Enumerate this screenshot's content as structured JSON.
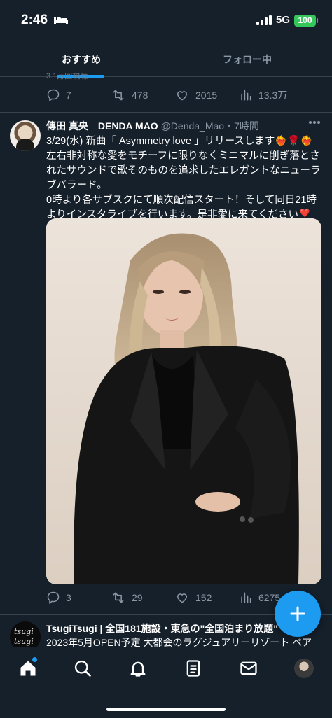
{
  "status_bar": {
    "time": "2:46",
    "network": "5G",
    "battery": "100"
  },
  "tabs": [
    {
      "label": "おすすめ",
      "active": true
    },
    {
      "label": "フォロー中",
      "active": false
    }
  ],
  "prev_tweet": {
    "cut_text": "3.1万回視聴",
    "replies": "7",
    "retweets": "478",
    "likes": "2015",
    "views": "13.3万"
  },
  "tweet": {
    "name": "傳田 真央　DENDA MAO",
    "handle": "@Denda_Mao",
    "time": "・7時間",
    "lines": [
      "3/29(水) 新曲「 Asymmetry love 」リリースします❤️‍🔥🌹❤️‍🔥",
      "左右非対称な愛をモチーフに限りなくミニマルに削ぎ落とされたサウンドで歌そのものを追求したエレガントなニューラブバラード。",
      "0時より各サブスクにて順次配信スタート！そして同日21時よりインスタライブを行います。是非愛に来てください❣️"
    ],
    "replies": "3",
    "retweets": "29",
    "likes": "152",
    "views": "6275"
  },
  "next_tweet": {
    "avatar_text_1": "tsugi",
    "avatar_text_2": "tsugi",
    "header": "TsugiTsugi | 全国181施設・東急の\"全国泊まり放題\"",
    "text": "2023年5月OPEN予定 大都会のラグジュアリーリゾート ペア"
  },
  "colors": {
    "background": "#15202b",
    "accent": "#1d9bf0",
    "secondary_text": "#8b98a5",
    "battery": "#34c759"
  },
  "icons": [
    "bed-icon",
    "signal-icon",
    "reply-icon",
    "retweet-icon",
    "like-icon",
    "views-icon",
    "share-icon",
    "more-icon",
    "compose-icon",
    "home-icon",
    "search-icon",
    "notifications-icon",
    "lists-icon",
    "messages-icon"
  ]
}
